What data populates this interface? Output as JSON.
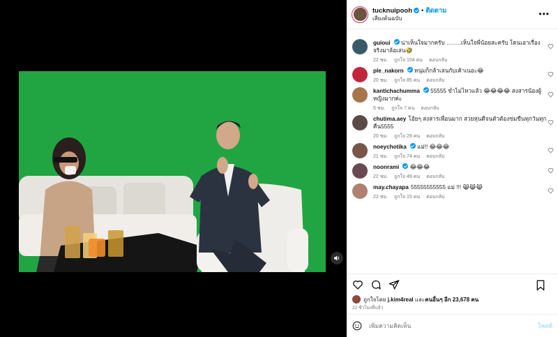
{
  "header": {
    "username": "tucknuipooh",
    "follow_label": "ติดตาม",
    "separator": "•",
    "subtitle": "เสียงต้นฉบับ",
    "more_icon": "more-horizontal-icon"
  },
  "comments": [
    {
      "user": "guioui",
      "verified": true,
      "text": "น่าเห็นใจมากครับ ……..เห็นใจพี่น้อยสะครับ โดนเอาเรื่องจริงมาล้อเล่น🤣",
      "age": "22 ชม.",
      "likes": "ถูกใจ 104 คน",
      "reply": "ตอบกลับ",
      "avatar_color": "#3a5a6a"
    },
    {
      "user": "ple_nakorn",
      "verified": true,
      "text": "หนุ่มก็กล้าเล่นกับเค้าเนอะ😂",
      "age": "20 ชม.",
      "likes": "ถูกใจ 85 คน",
      "reply": "ตอบกลับ",
      "avatar_color": "#c0283a"
    },
    {
      "user": "kantichachumma",
      "verified": true,
      "text": "55555 ข่ำไม่ไหวแล้ว 😂😂😂😂 สงสารน้องผู้หญิงมากค่ะ",
      "age": "5 ชม.",
      "likes": "ถูกใจ 7 คน",
      "reply": "ตอบกลับ",
      "avatar_color": "#a8744a"
    },
    {
      "user": "chutima.aey",
      "verified": false,
      "text": "โอ้ยๆ สงสารเพื่อนมาก สวยหุ่นดีจนตัวต้องข่มขืนทุกวันทุกคืน5555",
      "age": "20 ชม.",
      "likes": "ถูกใจ 29 คน",
      "reply": "ตอบกลับ",
      "avatar_color": "#5a4a48"
    },
    {
      "user": "noeychotika",
      "verified": true,
      "text": "แม่!! 😂😂😂",
      "age": "21 ชม.",
      "likes": "ถูกใจ 74 คน",
      "reply": "ตอบกลับ",
      "avatar_color": "#7a5548"
    },
    {
      "user": "noonrami",
      "verified": true,
      "text": "😂😂😂",
      "age": "22 ชม.",
      "likes": "ถูกใจ 49 คน",
      "reply": "ตอบกลับ",
      "avatar_color": "#6a4a52"
    },
    {
      "user": "may.chayapa",
      "verified": false,
      "text": "55555555555 แม่ !!! 😹😹😹",
      "age": "22 ชม.",
      "likes": "ถูกใจ 15 คน",
      "reply": "ตอบกลับ",
      "avatar_color": "#b08070"
    }
  ],
  "actions": {
    "like_icon": "heart-icon",
    "comment_icon": "comment-icon",
    "share_icon": "send-icon",
    "save_icon": "bookmark-icon"
  },
  "likes": {
    "prefix": "ถูกใจโดย",
    "user": "j.kim4real",
    "middle": "และ",
    "others": "คนอื่นๆ อีก 23,678 คน"
  },
  "time_ago": "22 ชั่วโมงที่แล้ว",
  "add_comment": {
    "placeholder": "เพิ่มความคิดเห็น",
    "post_label": "โพสต์",
    "emoji_icon": "smiley-icon"
  },
  "media": {
    "mute_icon": "volume-icon",
    "background_color": "#1fa241"
  }
}
